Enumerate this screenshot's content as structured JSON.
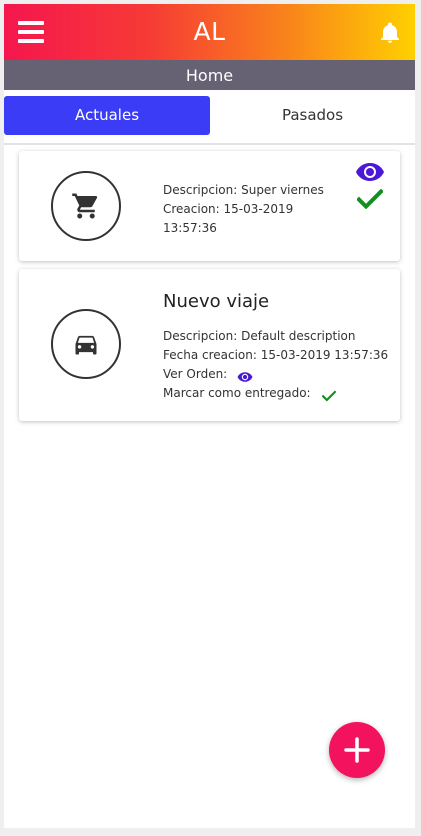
{
  "header": {
    "title": "AL",
    "gradient_start": "#f5164e",
    "gradient_end": "#ffd000",
    "menu_icon": "hamburger-menu-icon",
    "notification_icon": "bell-icon"
  },
  "subheader": {
    "title": "Home",
    "background": "#666173"
  },
  "tabs": [
    {
      "label": "Actuales",
      "active": true
    },
    {
      "label": "Pasados",
      "active": false
    }
  ],
  "accent_color": "#3a3cf6",
  "cards": [
    {
      "icon": "shopping-cart-icon",
      "lines": [
        "Descripcion: Super viernes",
        "Creacion: 15-03-2019",
        "13:57:36"
      ],
      "actions": [
        "eye-icon",
        "check-icon"
      ]
    },
    {
      "icon": "car-icon",
      "title": "Nuevo viaje",
      "lines": [
        "Descripcion: Default description",
        "Fecha creacion: 15-03-2019 13:57:36",
        "Ver Orden:",
        "Marcar como entregado:"
      ]
    }
  ],
  "status_colors": {
    "view": "#4a18d6",
    "done": "#12901f"
  },
  "fab": {
    "icon": "plus-icon",
    "color": "#f2125e"
  }
}
